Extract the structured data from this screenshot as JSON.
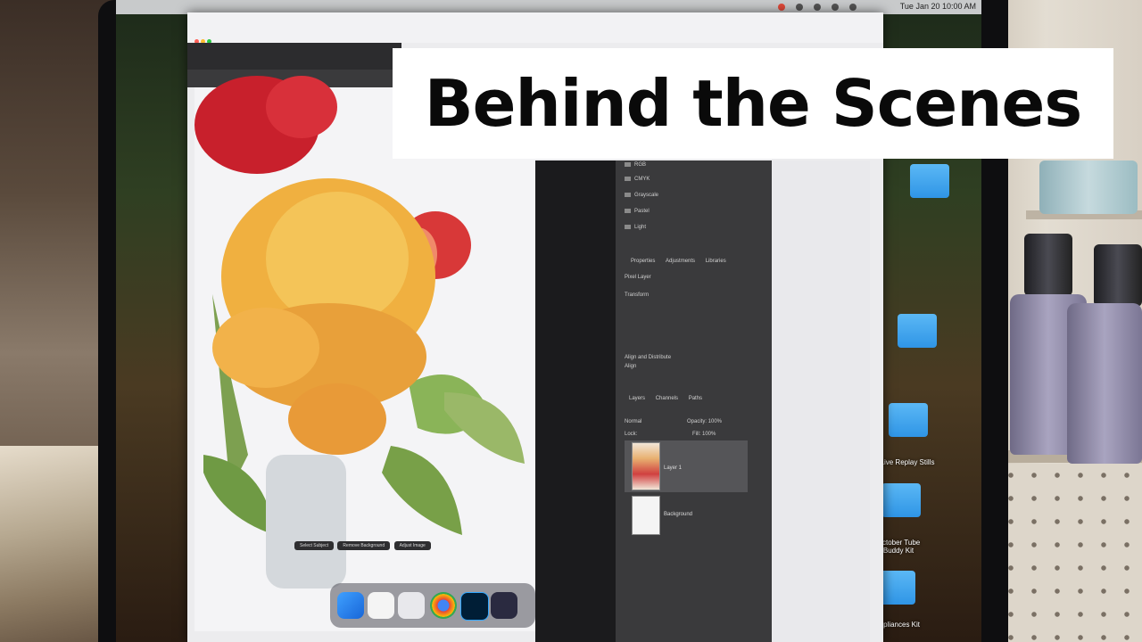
{
  "title_card": {
    "text": "Behind the Scenes"
  },
  "menubar": {
    "clock": "Tue Jan 20 10:00 AM"
  },
  "panels": {
    "folders": [
      "RGB",
      "CMYK",
      "Grayscale",
      "Pastel",
      "Light"
    ],
    "properties_tabs": [
      "Properties",
      "Adjustments",
      "Libraries"
    ],
    "pixel_layer": "Pixel Layer",
    "transform": "Transform",
    "align": "Align and Distribute",
    "align_sub": "Align",
    "layers_tabs": [
      "Layers",
      "Channels",
      "Paths"
    ],
    "blend_mode": "Normal",
    "opacity": "Opacity: 100%",
    "fill": "Fill: 100%",
    "lock": "Lock:",
    "layer_1": "Layer 1",
    "layer_bg": "Background"
  },
  "canvas_buttons": [
    "Select Subject",
    "Remove Background",
    "Adjust Image"
  ],
  "desktop_icons": [
    {
      "label": "Live Replay Stills"
    },
    {
      "label": "October Tube Buddy Kit"
    },
    {
      "label": "Pink Appliances Kit"
    }
  ],
  "colors": {
    "title_bg": "#ffffff",
    "title_text": "#0a0a0a",
    "folder_blue": "#3fa3ee",
    "panel_dark": "#3a3a3c"
  }
}
